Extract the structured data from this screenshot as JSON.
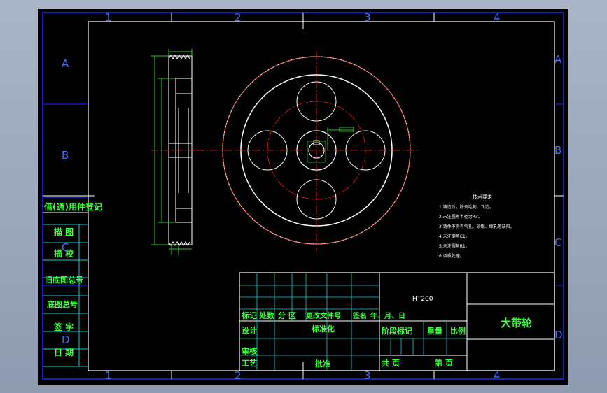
{
  "colors": {
    "background": "#000000",
    "frame_blue": "#1e2aff",
    "border_white": "#ffffff",
    "text_green": "#3cff3c",
    "text_white": "#ffffff",
    "text_blue": "#4a6bff",
    "center_red": "#ff1e1e",
    "table_cyan": "#18c8c8"
  },
  "zone_columns": [
    "1",
    "2",
    "3",
    "4"
  ],
  "zone_rows": [
    "A",
    "B",
    "C",
    "D"
  ],
  "left_strip": {
    "header": "借(通)用件登记",
    "items": [
      "描 图",
      "描 校",
      "旧底图总号",
      "底图总号",
      "签 字",
      "日 期"
    ]
  },
  "tech_requirements": {
    "title": "技术要求",
    "items": [
      "1.铸造后，除去毛刺、飞边。",
      "2.未注圆角半径为R3。",
      "3.铸件不得有气孔、砂眼、缩孔等缺陷。",
      "4.未注倒角C1。",
      "5.未注圆角R1。",
      "6.调质处理。"
    ]
  },
  "title_block": {
    "material": "HT200",
    "part_name": "大带轮",
    "revision_header": [
      "标记",
      "处数",
      "分 区",
      "更改文件号",
      "签名",
      "年、月、日"
    ],
    "design": "设计",
    "standardization": "标准化",
    "review": "审核",
    "process": "工艺",
    "approve": "批准",
    "stage_mark": "阶段标记",
    "weight": "重量",
    "scale": "比例",
    "sheets_total": "共 页",
    "sheet_no": "第 页"
  }
}
